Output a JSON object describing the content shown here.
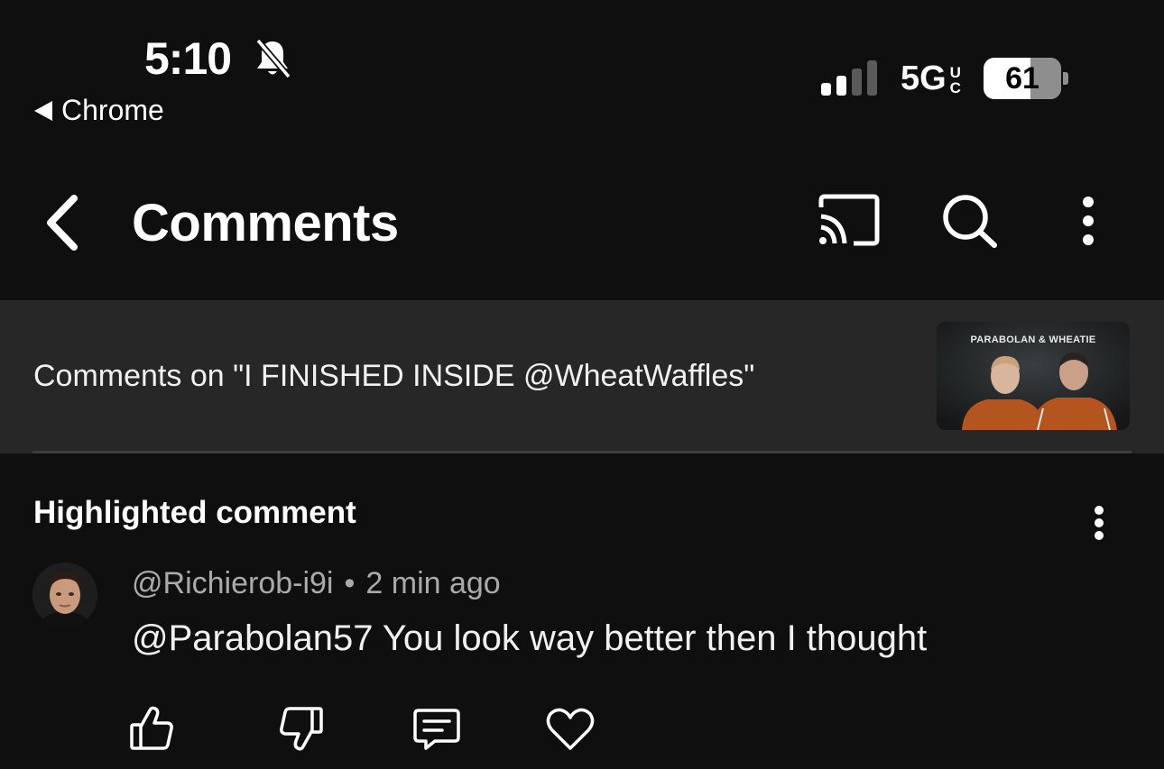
{
  "status_bar": {
    "time": "5:10",
    "back_app": "Chrome",
    "network": "5G",
    "network_suffix_top": "U",
    "network_suffix_bottom": "C",
    "battery_percent": "61",
    "battery_level": 0.61,
    "signal_bars_active": 2,
    "signal_bars_total": 4,
    "silent_icon": "bell-slash-icon"
  },
  "header": {
    "title": "Comments",
    "back_icon": "chevron-left-icon",
    "cast_icon": "cast-icon",
    "search_icon": "search-icon",
    "more_icon": "more-vertical-icon"
  },
  "video": {
    "banner_text": "Comments on \"I FINISHED INSIDE @WheatWaffles\"",
    "thumbnail_title": "PARABOLAN & WHEATIE"
  },
  "highlighted": {
    "label": "Highlighted comment",
    "author": "@Richierob-i9i",
    "separator": "•",
    "time": "2 min ago",
    "text": "@Parabolan57 You look way better then I thought",
    "actions": [
      "like-icon",
      "dislike-icon",
      "reply-icon",
      "heart-icon"
    ]
  },
  "colors": {
    "background": "#0f0f0f",
    "banner": "#272727",
    "meta_text": "#aaaaaa",
    "thumbnail_jacket": "#b4541e"
  }
}
